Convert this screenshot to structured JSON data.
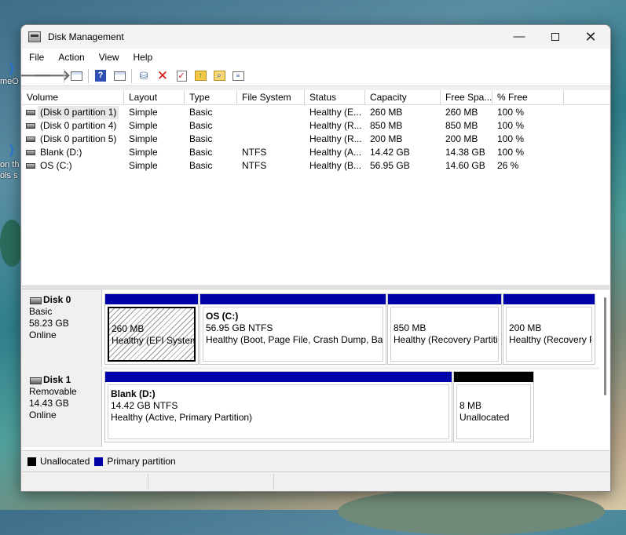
{
  "window": {
    "title": "Disk Management",
    "controls": {
      "minimize": "—",
      "maximize": "",
      "close": "✕"
    }
  },
  "menu": [
    "File",
    "Action",
    "View",
    "Help"
  ],
  "toolbar": {
    "icons": [
      "back-icon",
      "forward-icon",
      "show-hide-console-tree-icon",
      "help-icon",
      "show-hide-action-pane-icon",
      "connect-icon",
      "delete-icon",
      "check-icon",
      "folder-up-icon",
      "folder-search-icon",
      "properties-icon"
    ]
  },
  "volumes": {
    "columns": [
      "Volume",
      "Layout",
      "Type",
      "File System",
      "Status",
      "Capacity",
      "Free Spa...",
      "% Free"
    ],
    "rows": [
      {
        "volume": "(Disk 0 partition 1)",
        "layout": "Simple",
        "type": "Basic",
        "fs": "",
        "status": "Healthy (E...",
        "capacity": "260 MB",
        "free": "260 MB",
        "pct": "100 %"
      },
      {
        "volume": "(Disk 0 partition 4)",
        "layout": "Simple",
        "type": "Basic",
        "fs": "",
        "status": "Healthy (R...",
        "capacity": "850 MB",
        "free": "850 MB",
        "pct": "100 %"
      },
      {
        "volume": "(Disk 0 partition 5)",
        "layout": "Simple",
        "type": "Basic",
        "fs": "",
        "status": "Healthy (R...",
        "capacity": "200 MB",
        "free": "200 MB",
        "pct": "100 %"
      },
      {
        "volume": "Blank (D:)",
        "layout": "Simple",
        "type": "Basic",
        "fs": "NTFS",
        "status": "Healthy (A...",
        "capacity": "14.42 GB",
        "free": "14.38 GB",
        "pct": "100 %"
      },
      {
        "volume": "OS (C:)",
        "layout": "Simple",
        "type": "Basic",
        "fs": "NTFS",
        "status": "Healthy (B...",
        "capacity": "56.95 GB",
        "free": "14.60 GB",
        "pct": "26 %"
      }
    ]
  },
  "disks": [
    {
      "name": "Disk 0",
      "kind": "Basic",
      "size": "58.23 GB",
      "state": "Online",
      "partitions": [
        {
          "name": "",
          "line1": "260 MB",
          "line2": "Healthy (EFI System Partition)"
        },
        {
          "name": "OS  (C:)",
          "line1": "56.95 GB NTFS",
          "line2": "Healthy (Boot, Page File, Crash Dump, Basic Data Partition)"
        },
        {
          "name": "",
          "line1": "850 MB",
          "line2": "Healthy (Recovery Partition)"
        },
        {
          "name": "",
          "line1": "200 MB",
          "line2": "Healthy (Recovery Partition)"
        }
      ]
    },
    {
      "name": "Disk 1",
      "kind": "Removable",
      "size": "14.43 GB",
      "state": "Online",
      "partitions": [
        {
          "name": "Blank  (D:)",
          "line1": "14.42 GB NTFS",
          "line2": "Healthy (Active, Primary Partition)"
        },
        {
          "name": "",
          "line1": "8 MB",
          "line2": "Unallocated"
        }
      ]
    }
  ],
  "legend": [
    {
      "label": "Unallocated",
      "color": "#000000"
    },
    {
      "label": "Primary partition",
      "color": "#0000a8"
    }
  ],
  "desktop": {
    "text1": "meO",
    "text2": "on th",
    "text3": "ols s"
  },
  "colors": {
    "primary_partition": "#0000a8",
    "unallocated": "#000000"
  }
}
